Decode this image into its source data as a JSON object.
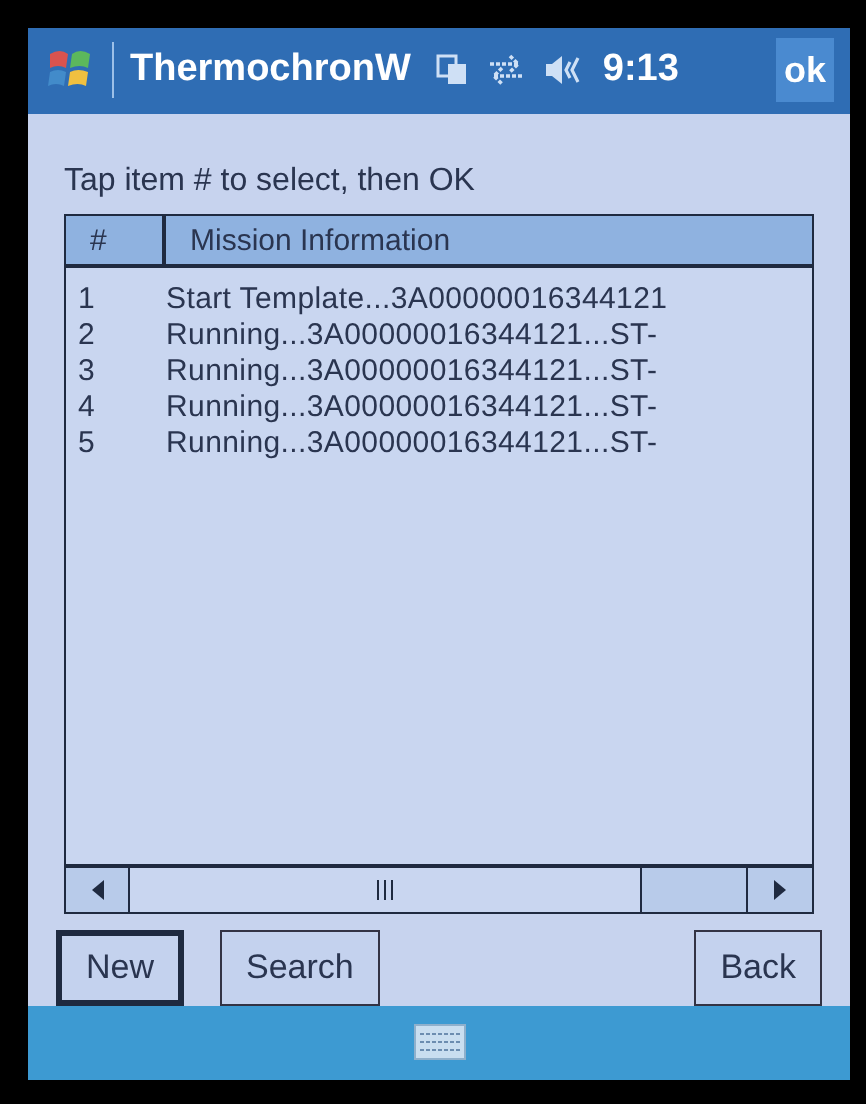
{
  "title_bar": {
    "title": "ThermochronW",
    "time": "9:13",
    "ok": "ok"
  },
  "instruction": "Tap item # to select, then OK",
  "table": {
    "columns": [
      "#",
      "Mission Information"
    ],
    "rows": [
      {
        "number": "1",
        "info": "Start Template...3A00000016344121"
      },
      {
        "number": "2",
        "info": "Running...3A00000016344121...ST-"
      },
      {
        "number": "3",
        "info": "Running...3A00000016344121...ST-"
      },
      {
        "number": "4",
        "info": "Running...3A00000016344121...ST-"
      },
      {
        "number": "5",
        "info": "Running...3A00000016344121...ST-"
      }
    ]
  },
  "buttons": [
    {
      "label": "New",
      "focused": true
    },
    {
      "label": "Search",
      "focused": false
    },
    {
      "label": "Back",
      "focused": false
    }
  ]
}
